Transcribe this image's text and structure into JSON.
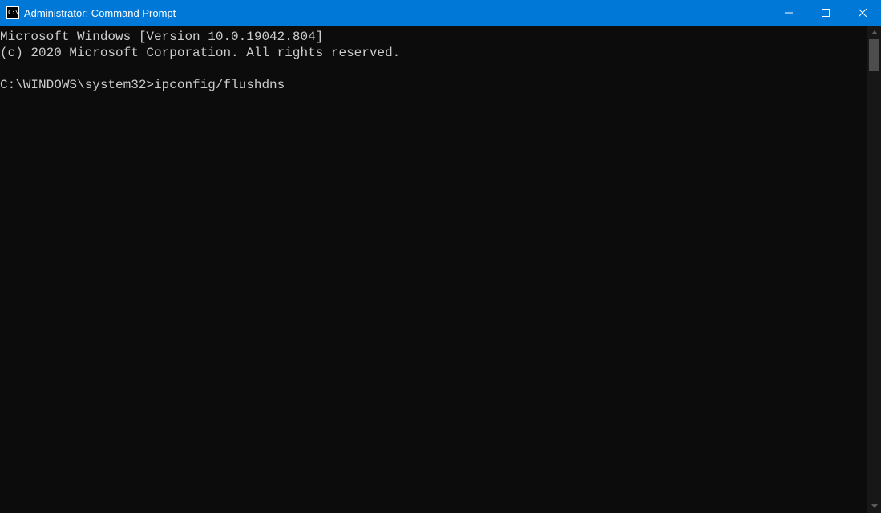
{
  "window": {
    "icon_text": "C:\\",
    "title": "Administrator: Command Prompt"
  },
  "terminal": {
    "line1": "Microsoft Windows [Version 10.0.19042.804]",
    "line2": "(c) 2020 Microsoft Corporation. All rights reserved.",
    "blank": "",
    "prompt": "C:\\WINDOWS\\system32>",
    "command": "ipconfig/flushdns"
  }
}
